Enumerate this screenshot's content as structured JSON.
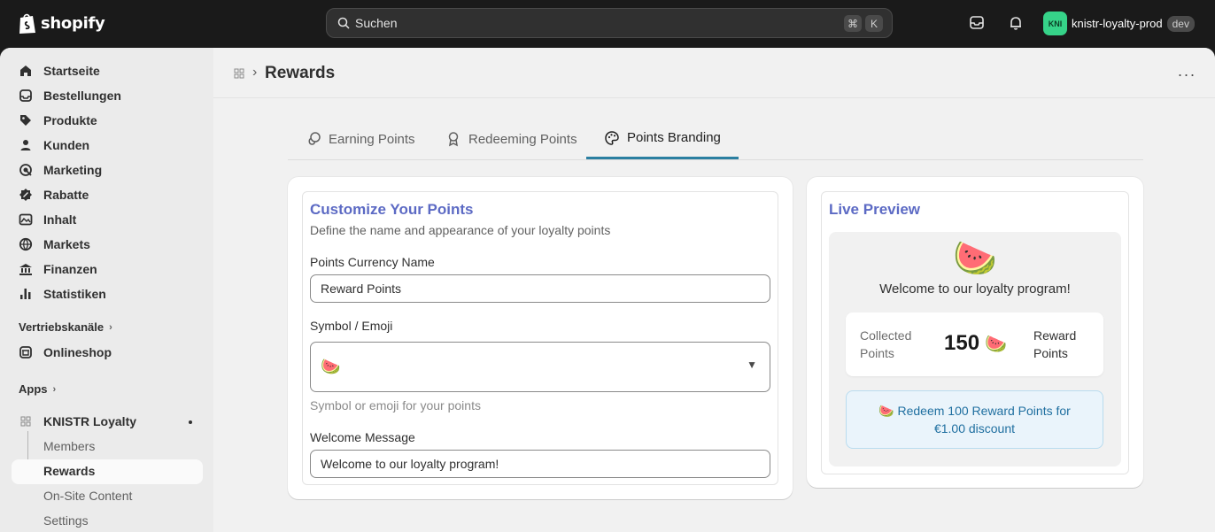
{
  "topbar": {
    "logo_text": "shopify",
    "search_placeholder": "Suchen",
    "shortcut_cmd": "⌘",
    "shortcut_key": "K",
    "store_initials": "KNI",
    "store_name": "knistr-loyalty-prod",
    "store_badge": "dev"
  },
  "sidebar": {
    "items": [
      {
        "label": "Startseite",
        "icon": "home-icon"
      },
      {
        "label": "Bestellungen",
        "icon": "inbox-icon"
      },
      {
        "label": "Produkte",
        "icon": "tag-icon"
      },
      {
        "label": "Kunden",
        "icon": "person-icon"
      },
      {
        "label": "Marketing",
        "icon": "target-icon"
      },
      {
        "label": "Rabatte",
        "icon": "discount-icon"
      },
      {
        "label": "Inhalt",
        "icon": "content-icon"
      },
      {
        "label": "Markets",
        "icon": "globe-icon"
      },
      {
        "label": "Finanzen",
        "icon": "bank-icon"
      },
      {
        "label": "Statistiken",
        "icon": "chart-icon"
      }
    ],
    "sales_channels_label": "Vertriebskanäle",
    "online_store_label": "Onlineshop",
    "apps_label": "Apps",
    "app_name": "KNISTR Loyalty",
    "app_sub_items": [
      "Members",
      "Rewards",
      "On-Site Content",
      "Settings"
    ]
  },
  "header": {
    "title": "Rewards"
  },
  "tabs": [
    {
      "label": "Earning Points"
    },
    {
      "label": "Redeeming Points"
    },
    {
      "label": "Points Branding"
    }
  ],
  "customize": {
    "title": "Customize Your Points",
    "subtitle": "Define the name and appearance of your loyalty points",
    "currency_label": "Points Currency Name",
    "currency_value": "Reward Points",
    "symbol_label": "Symbol / Emoji",
    "symbol_value": "🍉",
    "symbol_help": "Symbol or emoji for your points",
    "welcome_label": "Welcome Message",
    "welcome_value": "Welcome to our loyalty program!"
  },
  "preview": {
    "title": "Live Preview",
    "emoji": "🍉",
    "welcome": "Welcome to our loyalty program!",
    "collected_label": "Collected Points",
    "points_value": "150",
    "points_emoji": "🍉",
    "points_name": "Reward Points",
    "redeem_text": "🍉 Redeem 100 Reward Points for €1.00 discount"
  },
  "colors": {
    "accent_title": "#5c6ac4",
    "tab_active_underline": "#2b7fa1",
    "redeem_bg": "#eaf4fb",
    "redeem_text": "#1f6fa0",
    "store_avatar": "#36d389"
  }
}
